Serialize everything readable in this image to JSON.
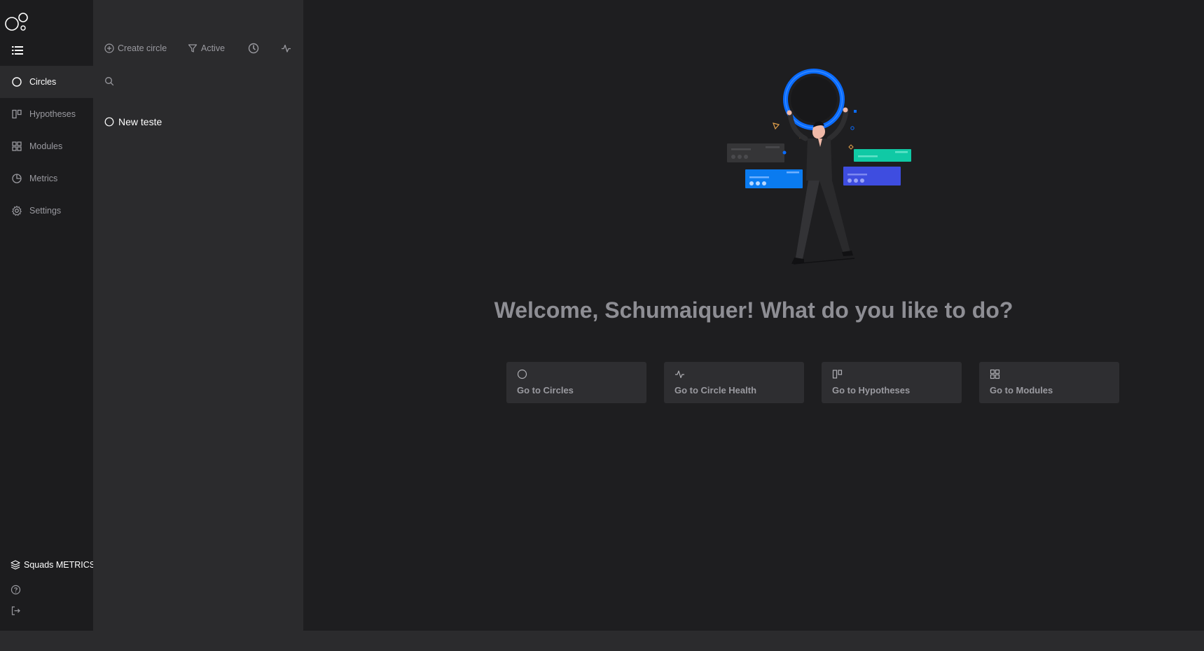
{
  "sidebar": {
    "logo_icon": "charles-circles-logo",
    "menu_icon": "list-menu-icon",
    "items": [
      {
        "label": "Circles",
        "icon": "circle-icon",
        "active": true
      },
      {
        "label": "Hypotheses",
        "icon": "kanban-icon",
        "active": false
      },
      {
        "label": "Modules",
        "icon": "grid-icon",
        "active": false
      },
      {
        "label": "Metrics",
        "icon": "pie-chart-icon",
        "active": false
      },
      {
        "label": "Settings",
        "icon": "gear-icon",
        "active": false
      }
    ],
    "workspace": "Squads METRICS",
    "help_icon": "help-circle-icon",
    "logout_icon": "logout-icon"
  },
  "panel": {
    "create_label": "Create circle",
    "filter_label": "Active",
    "circles": [
      {
        "name": "New teste"
      }
    ]
  },
  "main": {
    "welcome": "Welcome, Schumaiquer! What do you like to do?",
    "cards": [
      {
        "label": "Go to Circles",
        "icon": "circle-icon"
      },
      {
        "label": "Go to Circle Health",
        "icon": "activity-icon"
      },
      {
        "label": "Go to Hypotheses",
        "icon": "kanban-icon"
      },
      {
        "label": "Go to Modules",
        "icon": "grid-icon"
      }
    ]
  },
  "colors": {
    "sidebar_bg": "#1c1c1e",
    "panel_bg": "#2b2b2d",
    "main_bg": "#1e1e20",
    "accent_blue": "#0a6cff",
    "accent_teal": "#10c9a5",
    "accent_indigo": "#3e4de0"
  }
}
